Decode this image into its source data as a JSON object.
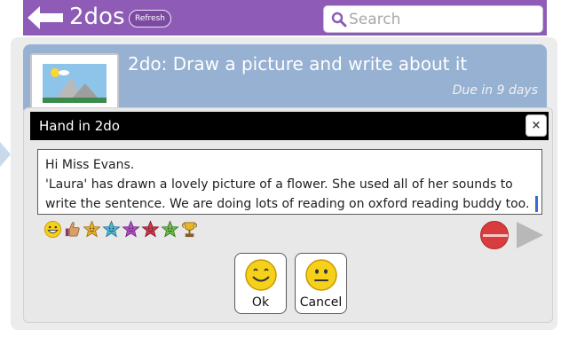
{
  "header": {
    "app_title": "2dos",
    "refresh_label": "Refresh",
    "search_placeholder": "Search",
    "search_value": ""
  },
  "task": {
    "title": "2do: Draw a picture and write about it",
    "due": "Due in 9 days"
  },
  "dialog": {
    "title": "Hand in 2do",
    "close_label": "×",
    "message_lines": [
      "Hi Miss Evans.",
      "'Laura' has drawn a lovely picture of a flower. She used all of her sounds to",
      "write the sentence. We are doing lots of reading on oxford reading buddy too."
    ],
    "stickers": [
      "grin-emoji-icon",
      "thumbs-up-icon",
      "star-gold-icon",
      "star-teal-icon",
      "star-purple-icon",
      "star-red-icon",
      "star-green-icon",
      "trophy-icon"
    ],
    "ok_label": "Ok",
    "cancel_label": "Cancel"
  },
  "colors": {
    "header": "#8e5bb6",
    "task_card": "#96b1d2",
    "titlebar": "#000000",
    "record": "#d93c3c"
  }
}
